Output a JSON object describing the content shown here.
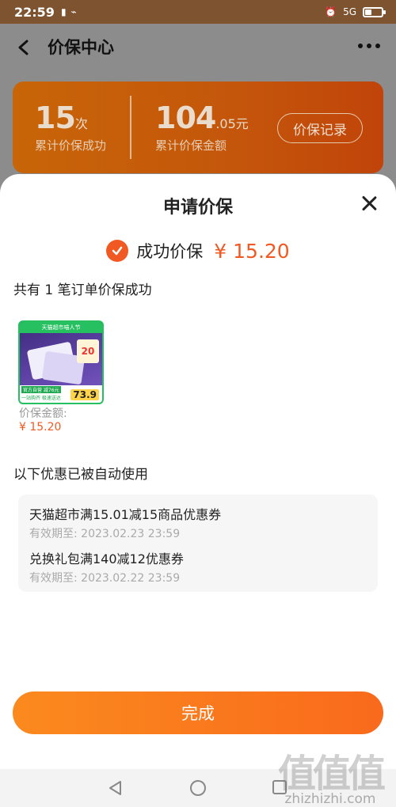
{
  "status_bar": {
    "time": "22:59",
    "signal": "5G"
  },
  "header": {
    "title": "价保中心"
  },
  "summary": {
    "success_count": "15",
    "success_unit": "次",
    "success_label": "累计价保成功",
    "total_amount": "104",
    "total_amount_decimal": ".05",
    "total_unit": "元",
    "total_label": "累计价保金额",
    "record_button": "价保记录"
  },
  "sheet": {
    "title": "申请价保",
    "success_text": "成功价保",
    "success_amount": "¥ 15.20",
    "orders_count": "共有 1 笔订单价保成功",
    "product": {
      "banner": "天猫超市喵人节",
      "badge": "20",
      "price": "73.9",
      "tag": "官方自营 减76元",
      "tag2": "一站购齐 极速送达"
    },
    "refund_label": "价保金额:",
    "refund_value": "¥ 15.20",
    "coupons_heading": "以下优惠已被自动使用",
    "coupons": [
      {
        "name": "天猫超市满15.01减15商品优惠券",
        "expiry": "有效期至: 2023.02.23 23:59"
      },
      {
        "name": "兑换礼包满140减12优惠券",
        "expiry": "有效期至: 2023.02.22 23:59"
      }
    ],
    "done_button": "完成"
  },
  "watermark": {
    "logo": "值值值",
    "url": "zhizhizhi.com"
  },
  "colors": {
    "accent": "#f05a22",
    "card": "#c4560b",
    "button": "#f96a1c"
  }
}
